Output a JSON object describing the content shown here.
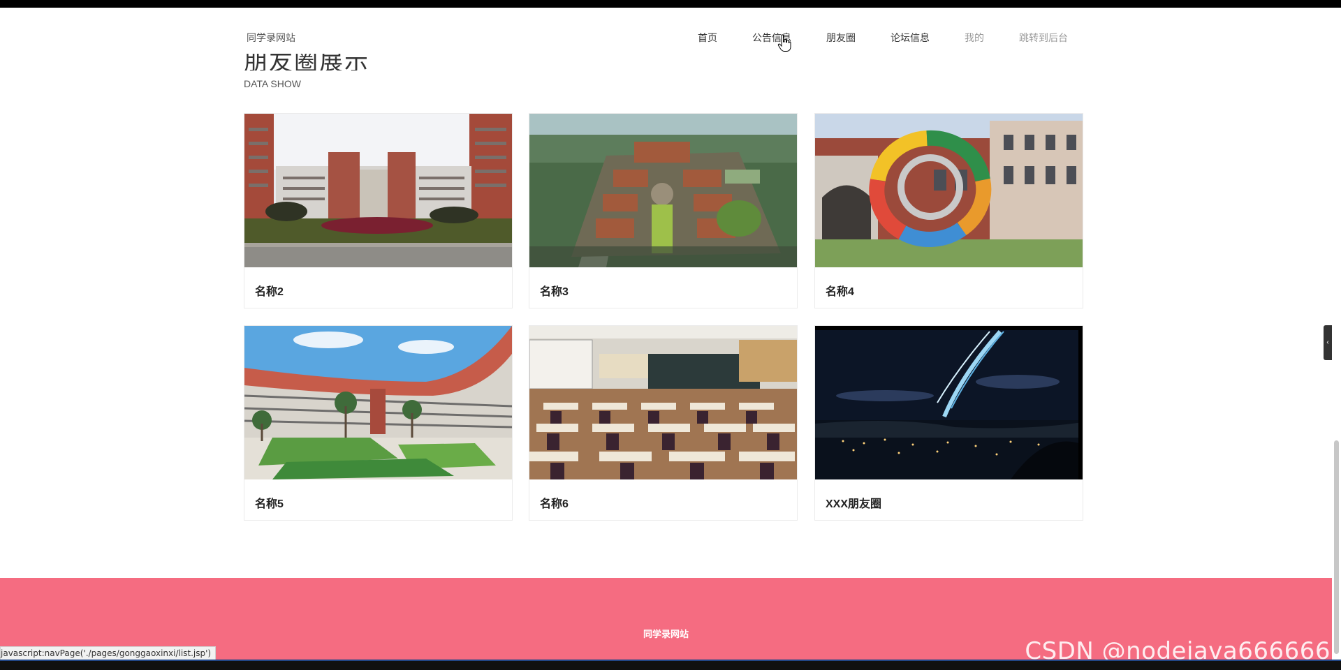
{
  "header": {
    "site_title": "同学录网站",
    "nav": [
      {
        "label": "首页"
      },
      {
        "label": "公告信息"
      },
      {
        "label": "朋友圈"
      },
      {
        "label": "论坛信息"
      },
      {
        "label": "我的"
      },
      {
        "label": "跳转到后台"
      }
    ]
  },
  "section": {
    "heading": "朋友圈展示",
    "subheading": "DATA SHOW"
  },
  "cards": [
    {
      "name": "名称2"
    },
    {
      "name": "名称3"
    },
    {
      "name": "名称4"
    },
    {
      "name": "名称5"
    },
    {
      "name": "名称6"
    },
    {
      "name": "XXX朋友圈"
    }
  ],
  "footer": {
    "text": "同学录网站",
    "watermark": "CSDN @nodejava666666"
  },
  "status_bar": {
    "url": "javascript:navPage('./pages/gonggaoxinxi/list.jsp')"
  },
  "colors": {
    "footer_bg": "#f56c81",
    "accent": "#f56c81"
  }
}
